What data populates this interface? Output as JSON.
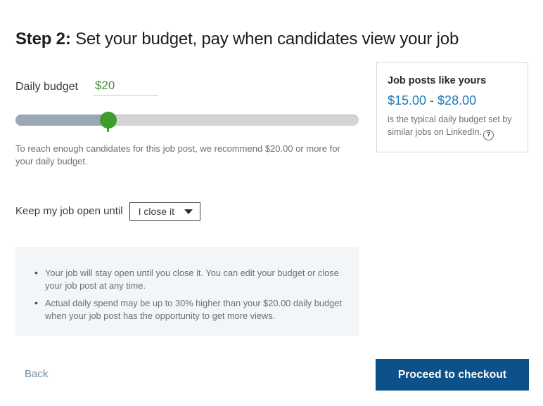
{
  "title": {
    "step": "Step 2:",
    "rest": " Set your budget, pay when candidates view your job"
  },
  "budget": {
    "label": "Daily budget",
    "value": "$20",
    "placeholder": "$20",
    "slider": {
      "percent": 27,
      "fill_color": "#9aa7b4",
      "track_color": "#d2d4d6",
      "thumb_color": "#3f9c2e"
    },
    "recommendation": "To reach enough candidates for this job post, we recommend $20.00 or more for your daily budget."
  },
  "side_card": {
    "title": "Job posts like yours",
    "range": "$15.00 - $28.00",
    "range_color": "#2079b5",
    "description": "is the typical daily budget set by similar jobs on LinkedIn.",
    "help_icon": "question-mark-icon",
    "help_glyph": "?"
  },
  "keep_open": {
    "label": "Keep my job open until",
    "selected": "I close it",
    "caret_icon": "chevron-down-icon"
  },
  "info": {
    "bullets": [
      "Your job will stay open until you close it. You can edit your budget or close your job post at any time.",
      "Actual daily spend may be up to 30% higher than your $20.00 daily budget when your job post has the opportunity to get more views."
    ]
  },
  "footer": {
    "back_label": "Back",
    "checkout_label": "Proceed to checkout",
    "checkout_color": "#0c5189"
  }
}
